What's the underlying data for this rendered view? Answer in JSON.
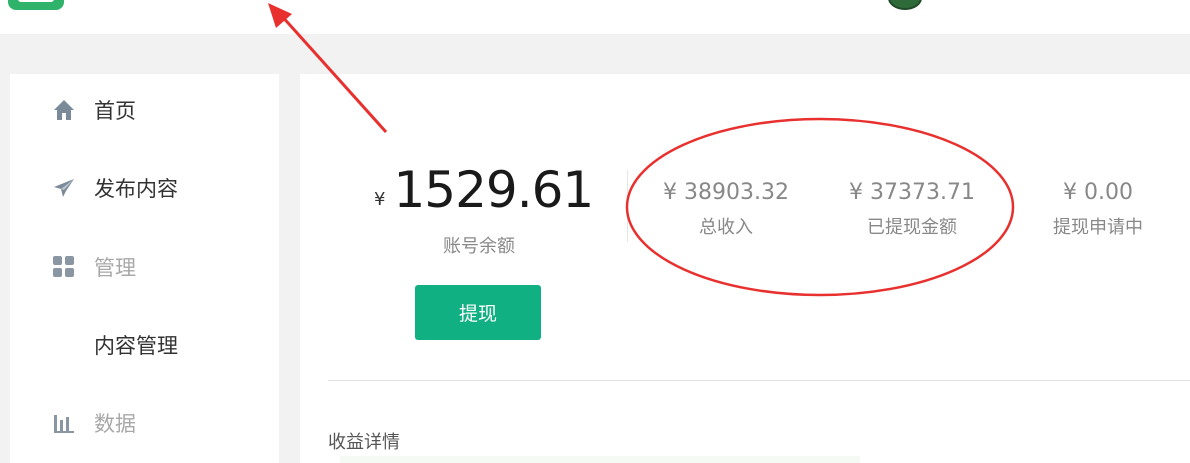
{
  "sidebar": {
    "items": [
      {
        "label": "首页",
        "icon": "home-icon",
        "muted": false
      },
      {
        "label": "发布内容",
        "icon": "send-icon",
        "muted": false
      },
      {
        "label": "管理",
        "icon": "grid-icon",
        "muted": true
      },
      {
        "label": "内容管理",
        "icon": "",
        "muted": false
      },
      {
        "label": "数据",
        "icon": "bar-chart-icon",
        "muted": true
      }
    ]
  },
  "balance": {
    "currency": "¥",
    "value": "1529.61",
    "label": "账号余额",
    "withdraw_button": "提现"
  },
  "stats": [
    {
      "value": "¥ 38903.32",
      "label": "总收入"
    },
    {
      "value": "¥ 37373.71",
      "label": "已提现金额"
    },
    {
      "value": "¥ 0.00",
      "label": "提现申请中"
    }
  ],
  "section": {
    "title": "收益详情"
  },
  "colors": {
    "accent": "#10b082",
    "annotation": "#e8312f",
    "text_muted": "#888888"
  }
}
